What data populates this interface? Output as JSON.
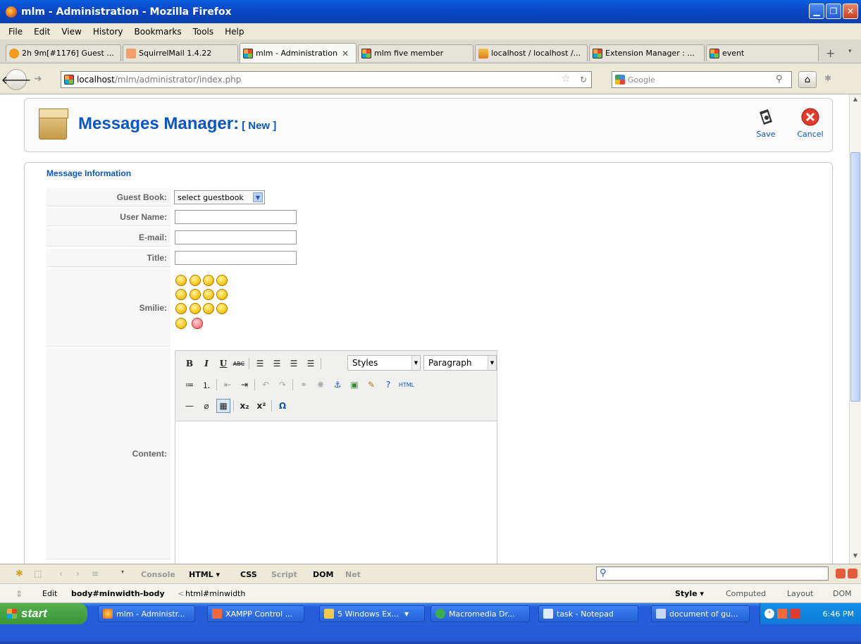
{
  "window": {
    "title": "mlm - Administration - Mozilla Firefox"
  },
  "menu": [
    "File",
    "Edit",
    "View",
    "History",
    "Bookmarks",
    "Tools",
    "Help"
  ],
  "tabs": [
    {
      "label": "2h 9m[#1176] Guest ..."
    },
    {
      "label": "SquirrelMail 1.4.22"
    },
    {
      "label": "mlm - Administration"
    },
    {
      "label": "mlm five member"
    },
    {
      "label": "localhost / localhost /..."
    },
    {
      "label": "Extension Manager : ..."
    },
    {
      "label": "event"
    }
  ],
  "address": {
    "host": "localhost",
    "path": "/mlm/administrator/index.php"
  },
  "search": {
    "placeholder": "Google"
  },
  "header": {
    "title": "Messages Manager:",
    "subtitle": "[ New ]",
    "save_label": "Save",
    "cancel_label": "Cancel"
  },
  "form": {
    "legend": "Message Information",
    "guestbook_label": "Guest Book:",
    "guestbook_value": "select guestbook",
    "username_label": "User Name:",
    "email_label": "E-mail:",
    "title_label": "Title:",
    "smilie_label": "Smilie:",
    "content_label": "Content:"
  },
  "editor": {
    "styles": "Styles",
    "format": "Paragraph",
    "html": "HTML"
  },
  "firebug": {
    "tabs": [
      "Console",
      "HTML ▾",
      "CSS",
      "Script",
      "DOM",
      "Net"
    ],
    "path_edit": "Edit",
    "path_current": "body#minwidth-body",
    "path_parent": "html#minwidth",
    "side_tabs": [
      "Style ▾",
      "Computed",
      "Layout",
      "DOM"
    ]
  },
  "taskbar": {
    "start": "start",
    "tasks": [
      "mlm - Administr...",
      "XAMPP Control ...",
      "5 Windows Ex...",
      "Macromedia Dr...",
      "task - Notepad",
      "document of gu..."
    ],
    "clock": "6:46 PM"
  }
}
